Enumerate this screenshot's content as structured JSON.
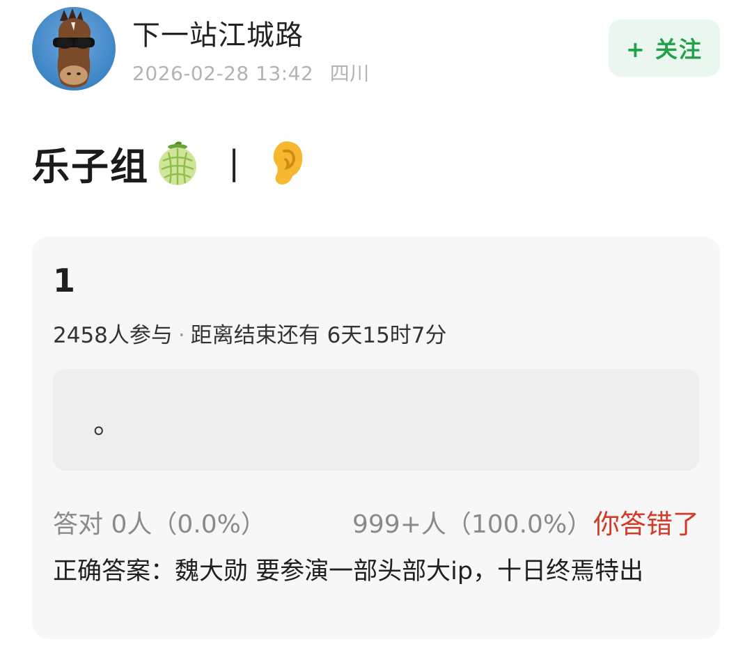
{
  "author": {
    "name": "下一站江城路",
    "datetime": "2026-02-28 13:42",
    "location": "四川"
  },
  "follow_button": {
    "label": "+ 关注"
  },
  "post": {
    "title": "乐子组",
    "title_emoji_1": "melon-emoji",
    "separator": "|",
    "title_emoji_2": "ear-emoji"
  },
  "quiz": {
    "title": "1",
    "participants": "2458人参与",
    "dot": "·",
    "countdown": "距离结束还有 6天15时7分",
    "option_text": "。",
    "correct_stat": "答对  0人（0.0%）",
    "wrong_stat": "999+人（100.0%）",
    "result_tag": "你答错了",
    "answer": "正确答案：魏大勋 要参演一部头部大ip，十日终焉特出"
  },
  "colors": {
    "follow_bg": "#e9f7ee",
    "follow_text": "#23a04a",
    "wrong": "#d23a2a",
    "card_bg": "#f7f7f7"
  }
}
